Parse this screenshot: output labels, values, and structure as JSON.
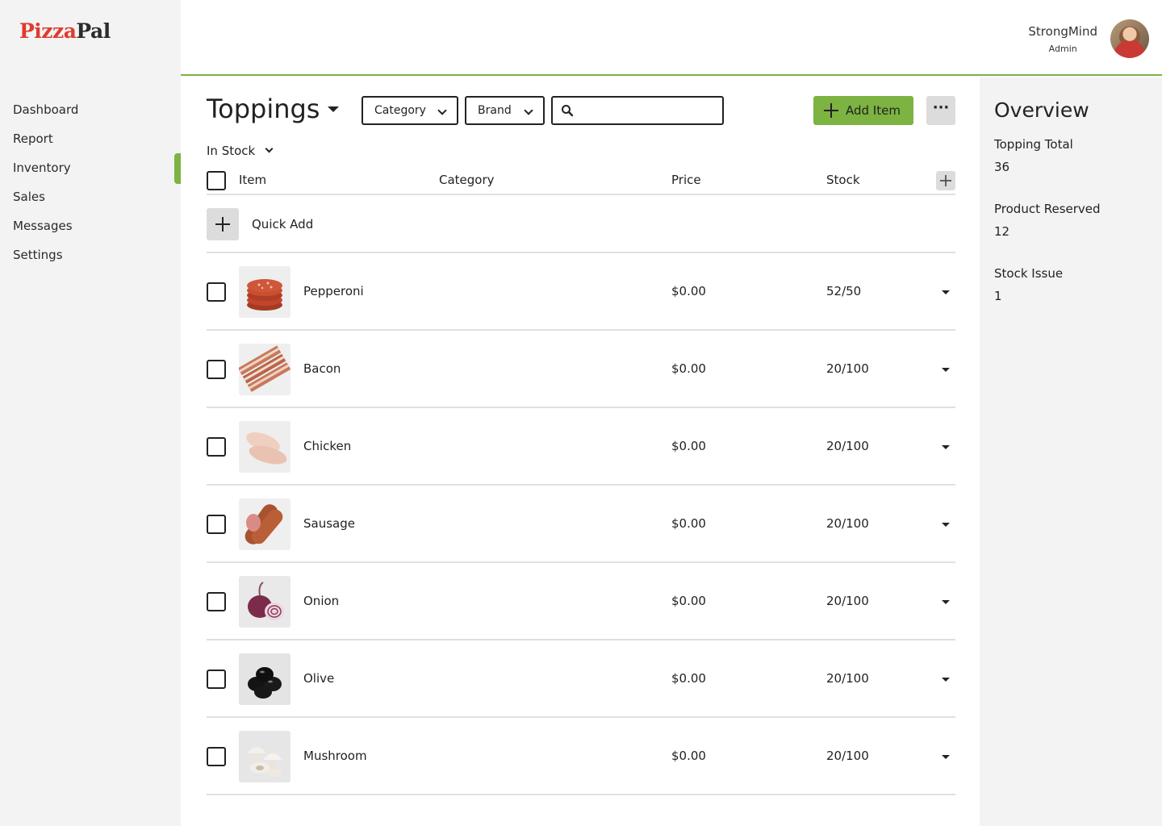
{
  "brand": {
    "logo_part1": "Pizza",
    "logo_part2": "Pal",
    "accent": "#7cb342",
    "logo_red": "#e03a2f"
  },
  "sidebar": {
    "items": [
      {
        "label": "Dashboard"
      },
      {
        "label": "Report"
      },
      {
        "label": "Inventory",
        "active": true
      },
      {
        "label": "Sales"
      },
      {
        "label": "Messages"
      },
      {
        "label": "Settings"
      }
    ]
  },
  "user": {
    "name": "StrongMind",
    "role": "Admin"
  },
  "main": {
    "title": "Toppings",
    "filters": {
      "category": "Category",
      "brand": "Brand"
    },
    "search": {
      "placeholder": "",
      "value": ""
    },
    "add_item_label": "Add Item",
    "more_icon": "ellipsis-icon",
    "stock_filter": "In Stock",
    "columns": {
      "item": "Item",
      "category": "Category",
      "price": "Price",
      "stock": "Stock"
    },
    "quick_add_label": "Quick Add",
    "rows": [
      {
        "name": "Pepperoni",
        "category": "",
        "price": "$0.00",
        "stock": "52/50",
        "image": "pepperoni-image"
      },
      {
        "name": "Bacon",
        "category": "",
        "price": "$0.00",
        "stock": "20/100",
        "image": "bacon-image"
      },
      {
        "name": "Chicken",
        "category": "",
        "price": "$0.00",
        "stock": "20/100",
        "image": "chicken-image"
      },
      {
        "name": "Sausage",
        "category": "",
        "price": "$0.00",
        "stock": "20/100",
        "image": "sausage-image"
      },
      {
        "name": "Onion",
        "category": "",
        "price": "$0.00",
        "stock": "20/100",
        "image": "onion-image"
      },
      {
        "name": "Olive",
        "category": "",
        "price": "$0.00",
        "stock": "20/100",
        "image": "olive-image"
      },
      {
        "name": "Mushroom",
        "category": "",
        "price": "$0.00",
        "stock": "20/100",
        "image": "mushroom-image"
      }
    ]
  },
  "overview": {
    "title": "Overview",
    "stats": [
      {
        "label": "Topping Total",
        "value": "36"
      },
      {
        "label": "Product Reserved",
        "value": "12"
      },
      {
        "label": "Stock Issue",
        "value": "1"
      }
    ]
  }
}
